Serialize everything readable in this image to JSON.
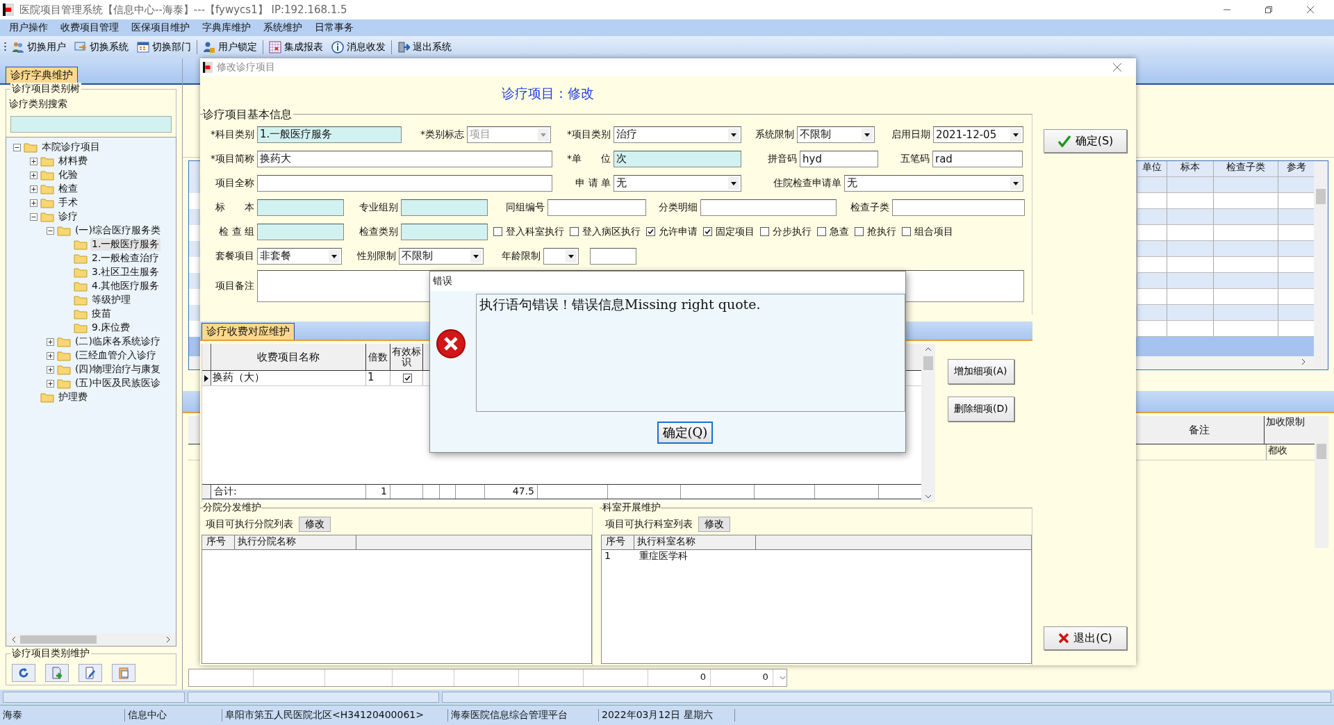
{
  "window": {
    "title": "医院项目管理系统【信息中心--海泰】---【fywycs1】 IP:192.168.1.5"
  },
  "menu": [
    "用户操作",
    "收费项目管理",
    "医保项目维护",
    "字典库维护",
    "系统维护",
    "日常事务"
  ],
  "toolbar": [
    {
      "label": "切换用户",
      "kind": "users"
    },
    {
      "label": "切换系统",
      "kind": "switch"
    },
    {
      "label": "切换部门",
      "kind": "calendar"
    },
    {
      "label": "用户锁定",
      "kind": "lock"
    },
    {
      "label": "集成报表",
      "kind": "report"
    },
    {
      "label": "消息收发",
      "kind": "info"
    },
    {
      "label": "退出系统",
      "kind": "exit"
    }
  ],
  "main_tab": {
    "label": "诊疗字典维护",
    "selected": true
  },
  "category_tree": {
    "title": "诊疗项目类别树",
    "search_label": "诊疗类别搜索",
    "items": [
      {
        "label": "本院诊疗项目",
        "expanded": true,
        "selected": false,
        "children": [
          {
            "label": "材料费",
            "expanded": false,
            "selected": false
          },
          {
            "label": "化验",
            "expanded": false,
            "selected": false
          },
          {
            "label": "检查",
            "expanded": false,
            "selected": false
          },
          {
            "label": "手术",
            "expanded": false,
            "selected": false
          },
          {
            "label": "诊疗",
            "expanded": true,
            "selected": false,
            "children": [
              {
                "label": "(一)综合医疗服务类",
                "expanded": true,
                "selected": false,
                "children": [
                  {
                    "label": "1.一般医疗服务",
                    "selected": true
                  },
                  {
                    "label": "2.一般检查治疗",
                    "selected": false
                  },
                  {
                    "label": "3.社区卫生服务",
                    "selected": false
                  },
                  {
                    "label": "4.其他医疗服务",
                    "selected": false
                  },
                  {
                    "label": "等级护理",
                    "selected": false
                  },
                  {
                    "label": "疫苗",
                    "selected": false
                  },
                  {
                    "label": "9.床位费",
                    "selected": false
                  }
                ]
              },
              {
                "label": "(二)临床各系统诊疗",
                "expanded": false,
                "selected": false
              },
              {
                "label": "(三经血管介入诊疗",
                "expanded": false,
                "selected": false
              },
              {
                "label": "(四)物理治疗与康复",
                "expanded": false,
                "selected": false
              },
              {
                "label": "(五)中医及民族医诊",
                "expanded": false,
                "selected": false
              }
            ]
          },
          {
            "label": "护理费",
            "selected": false
          }
        ]
      }
    ]
  },
  "category_maintenance": {
    "title": "诊疗项目类别维护",
    "buttons": [
      {
        "kind": "refresh"
      },
      {
        "kind": "add"
      },
      {
        "kind": "edit"
      },
      {
        "kind": "paste"
      }
    ]
  },
  "background_grid": {
    "columns": [
      "单位",
      "标本",
      "检查子类",
      "参考"
    ]
  },
  "background_detail_grid": {
    "columns": [
      "备注",
      "加收限制"
    ],
    "rows": [
      [
        "",
        "都收"
      ]
    ]
  },
  "footer_row": {
    "values": [
      "0",
      "0"
    ]
  },
  "dialog": {
    "title": "修改诊疗项目",
    "heading": "诊疗项目：修改",
    "section_title": "诊疗项目基本信息",
    "rows": [
      {
        "fields": [
          {
            "label": "*科目类别",
            "kind": "text",
            "value": "1.一般医疗服务",
            "highlighted": true
          },
          {
            "label": "*类别标志",
            "kind": "select",
            "value": "项目",
            "disabled": true
          },
          {
            "label": "*项目类别",
            "kind": "select",
            "value": "治疗"
          },
          {
            "label": "系统限制",
            "kind": "select",
            "value": "不限制"
          },
          {
            "label": "启用日期",
            "kind": "select",
            "value": "2021-12-05"
          }
        ]
      },
      {
        "fields": [
          {
            "label": "*项目简称",
            "kind": "text",
            "value": "换药大"
          },
          {
            "label": "*单　　位",
            "kind": "text",
            "value": "次",
            "highlighted": true
          },
          {
            "label": "拼音码",
            "kind": "text",
            "value": "hyd"
          },
          {
            "label": "五笔码",
            "kind": "text",
            "value": "rad"
          }
        ]
      },
      {
        "fields": [
          {
            "label": "项目全称",
            "kind": "text"
          },
          {
            "label": "申 请 单",
            "kind": "select",
            "value": "无"
          },
          {
            "label": "住院检查申请单",
            "kind": "select",
            "value": "无"
          }
        ]
      },
      {
        "fields": [
          {
            "label": "标　　本",
            "kind": "text",
            "highlighted": true
          },
          {
            "label": "专业组别",
            "kind": "text",
            "highlighted": true
          },
          {
            "label": "同组编号",
            "kind": "text"
          },
          {
            "label": "分类明细",
            "kind": "text"
          },
          {
            "label": "检查子类",
            "kind": "text"
          }
        ]
      },
      {
        "fields": [
          {
            "label": "检 查 组",
            "kind": "text",
            "highlighted": true
          },
          {
            "label": "检查类别",
            "kind": "text",
            "highlighted": true
          },
          {
            "label": "登入科室执行",
            "kind": "checkbox",
            "checked": false
          },
          {
            "label": "登入病区执行",
            "kind": "checkbox",
            "checked": false
          },
          {
            "label": "允许申请",
            "kind": "checkbox",
            "checked": true
          },
          {
            "label": "固定项目",
            "kind": "checkbox",
            "checked": true
          },
          {
            "label": "分步执行",
            "kind": "checkbox",
            "checked": false
          },
          {
            "label": "急查",
            "kind": "checkbox",
            "checked": false
          },
          {
            "label": "抢执行",
            "kind": "checkbox",
            "checked": false
          },
          {
            "label": "组合项目",
            "kind": "checkbox",
            "checked": false
          }
        ]
      },
      {
        "fields": [
          {
            "label": "套餐项目",
            "kind": "select",
            "value": "非套餐"
          },
          {
            "label": "性别限制",
            "kind": "select",
            "value": "不限制"
          },
          {
            "label": "年龄限制",
            "kind": "select"
          },
          {
            "kind": "text"
          }
        ]
      },
      {
        "fields": [
          {
            "label": "项目备注",
            "kind": "textarea"
          }
        ]
      }
    ],
    "fee_tab": {
      "label": "诊疗收费对应维护",
      "selected": true
    },
    "fee_grid": {
      "columns": [
        "收费项目名称",
        "倍数",
        "有效标识"
      ],
      "rows": [
        {
          "name": "换药（大）",
          "multiplier": "1",
          "valid": true
        }
      ],
      "totals": {
        "label": "合计:",
        "multiplier": "1",
        "amount": "47.5"
      }
    },
    "fee_buttons": [
      "增加细项(A)",
      "删除细项(D)"
    ],
    "branch_groups": [
      {
        "title": "分院分发维护",
        "list_label": "项目可执行分院列表",
        "button": "修改",
        "columns": [
          "序号",
          "执行分院名称"
        ]
      },
      {
        "title": "科室开展维护",
        "list_label": "项目可执行科室列表",
        "button": "修改",
        "columns": [
          "序号",
          "执行科室名称"
        ],
        "rows": [
          [
            "1",
            "重症医学科"
          ]
        ]
      }
    ],
    "confirm_button": "确定(S)",
    "exit_button": "退出(C)"
  },
  "error_dialog": {
    "title": "错误",
    "message": "执行语句错误！错误信息Missing right quote.",
    "button": "确定(Q)"
  },
  "status_bar": [
    "海泰",
    "信息中心",
    "阜阳市第五人民医院北区<H34120400061>",
    "海泰医院信息综合管理平台",
    "2022年03月12日 星期六"
  ]
}
